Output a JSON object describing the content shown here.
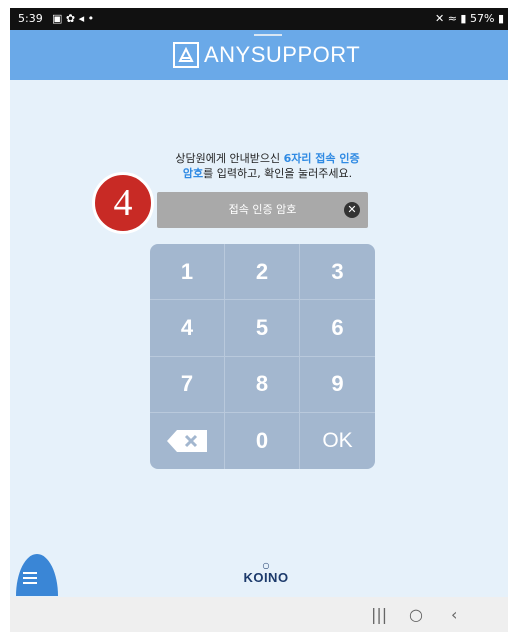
{
  "status_bar": {
    "time": "5:39",
    "battery": "57%"
  },
  "header": {
    "logo_text": "ANYSUPPORT"
  },
  "instruction": {
    "part1": "상담원에게 안내받으신 ",
    "highlight1": "6자리 접속 인증",
    "highlight2": "암호",
    "part2": "를 입력하고, 확인을 눌러주세요."
  },
  "step_badge": "4",
  "code_input": {
    "placeholder": "접속 인증 암호",
    "value": ""
  },
  "keypad": {
    "keys": [
      "1",
      "2",
      "3",
      "4",
      "5",
      "6",
      "7",
      "8",
      "9",
      "",
      "0",
      "OK"
    ]
  },
  "footer": {
    "brand": "KOINO"
  },
  "colors": {
    "header": "#6aa9e8",
    "keypad": "#a3b7cf",
    "badge": "#c82a25",
    "highlight": "#2f8ae3"
  }
}
